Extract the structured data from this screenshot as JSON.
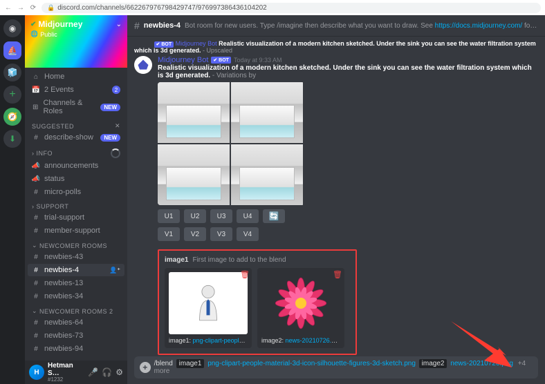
{
  "browser": {
    "url": "discord.com/channels/662267976798429747/976997386436104202"
  },
  "server": {
    "name": "Midjourney",
    "public": "Public"
  },
  "sidebar": {
    "home": "Home",
    "events": "2 Events",
    "events_count": 2,
    "channels_roles": "Channels & Roles",
    "new": "NEW",
    "cat_suggested": "SUGGESTED",
    "describe_show": "describe-show",
    "cat_info": "INFO",
    "announcements": "announcements",
    "status": "status",
    "micro_polls": "micro-polls",
    "cat_support": "SUPPORT",
    "trial_support": "trial-support",
    "member_support": "member-support",
    "cat_nr1": "NEWCOMER ROOMS",
    "nb43": "newbies-43",
    "nb4": "newbies-4",
    "nb13": "newbies-13",
    "nb34": "newbies-34",
    "cat_nr2": "NEWCOMER ROOMS 2",
    "nb64": "newbies-64",
    "nb73": "newbies-73",
    "nb94": "newbies-94"
  },
  "user": {
    "name": "Hetman S…",
    "tag": "#1232"
  },
  "channel": {
    "name": "newbies-4",
    "topic_pre": "Bot room for new users. Type /imagine then describe what you want to draw. See ",
    "topic_link": "https://docs.midjourney.com/",
    "topic_post": " for more information"
  },
  "msg1": {
    "author": "Midjourney Bot",
    "bot": "✔ BOT",
    "text_bold": "Realistic visualization of a modern kitchen sketched. Under the sink you can see the water filtration system which is 3d generated.",
    "text_dim": " - Upscaled"
  },
  "msg2": {
    "author": "Midjourney Bot",
    "bot": "✔ BOT",
    "time": "Today at 9:33 AM",
    "text_bold": "Realistic visualization of a modern kitchen sketched. Under the sink you can see the water filtration system which is 3d generated.",
    "text_dim": " - Variations by"
  },
  "buttons": {
    "U1": "U1",
    "U2": "U2",
    "U3": "U3",
    "U4": "U4",
    "V1": "V1",
    "V2": "V2",
    "V3": "V3",
    "V4": "V4"
  },
  "blend": {
    "param": "image1",
    "desc": "First image to add to the blend",
    "a1_label": "image1:",
    "a1_file": "png-clipart-people-…",
    "a2_label": "image2:",
    "a2_file": "news-20210726.png"
  },
  "input": {
    "slash": "/blend",
    "p1": "image1",
    "f1": "png-clipart-people-material-3d-icon-silhouette-figures-3d-sketch.png",
    "p2": "image2",
    "f2": "news-20210726.png",
    "more": "+4 more"
  }
}
